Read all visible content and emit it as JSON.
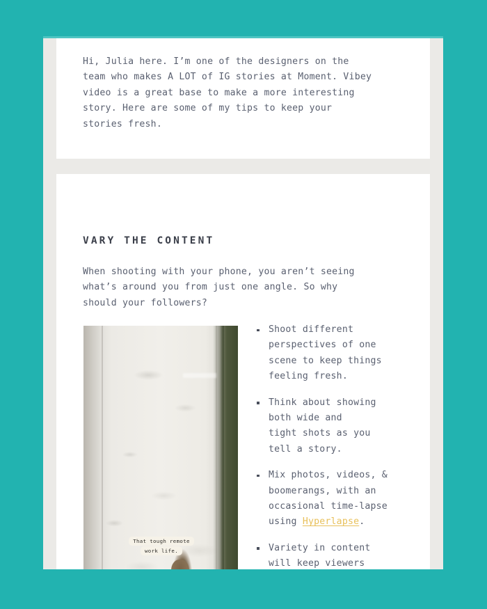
{
  "theme": {
    "background_color": "#22b3b0",
    "frame_color": "#ebeae7",
    "card_color": "#ffffff",
    "text_color": "#5a6070",
    "heading_color": "#3b3f4a",
    "link_color": "#e8c05a"
  },
  "intro_card": {
    "paragraph": "Hi, Julia here. I’m one of the designers on the\nteam who makes A LOT of IG stories at Moment. Vibey\nvideo is a great base to make a more interesting\nstory. Here are some of my tips to keep your\nstories fresh."
  },
  "main_card": {
    "heading": "VARY THE CONTENT",
    "paragraph": "When shooting with your phone, you aren’t seeing\nwhat’s around you from just one angle. So why\nshould your followers?",
    "photo": {
      "alt": "Overhead phone photo looking down a concrete sidewalk with grass along the right edge and the photographer’s feet at the bottom",
      "sticker_lines": [
        "That tough remote",
        "work life."
      ]
    },
    "bullets": [
      {
        "text_before_link": "Shoot different\nperspectives of one\nscene to keep things\nfeeling fresh.",
        "link_text": "",
        "text_after_link": ""
      },
      {
        "text_before_link": "Think about showing\nboth wide and\ntight shots as you\ntell a story.",
        "link_text": "",
        "text_after_link": ""
      },
      {
        "text_before_link": "Mix photos, videos, &\nboomerangs, with an\noccasional time-lapse\nusing ",
        "link_text": "Hyperlapse",
        "text_after_link": "."
      },
      {
        "text_before_link": "Variety in content\nwill keep viewers\ntapping instead of\nswiping away.",
        "link_text": "",
        "text_after_link": ""
      }
    ]
  }
}
